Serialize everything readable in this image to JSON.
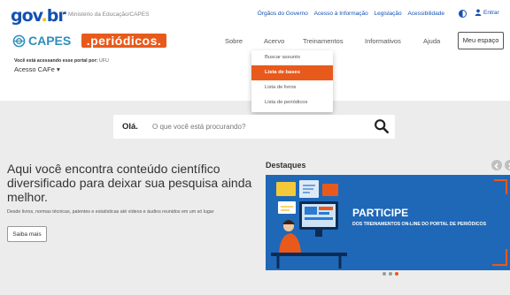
{
  "gov_bar": {
    "logo_parts": [
      "gov",
      ".",
      "br"
    ],
    "ministry": "Ministério da Educação/CAPES",
    "links": [
      "Órgãos do Governo",
      "Acesso à Informação",
      "Legislação",
      "Acessibilidade"
    ],
    "login_label": "Entrar"
  },
  "header": {
    "capes_label": "CAPES",
    "periodicos_label": ".periódicos.",
    "nav": [
      "Sobre",
      "Acervo",
      "Treinamentos",
      "Informativos",
      "Ajuda"
    ],
    "meu_espaco": "Meu espaço",
    "access_text": "Você está acessando esse portal por:",
    "access_institution": "UFU",
    "access_method": "Acesso CAFe"
  },
  "acervo_menu": {
    "items": [
      "Buscar assunto",
      "Lista de bases",
      "Lista de livros",
      "Lista de periódicos"
    ],
    "active_index": 1
  },
  "search": {
    "greeting": "Olá.",
    "placeholder": "O que você está procurando?"
  },
  "hero": {
    "title": "Aqui você encontra conteúdo científico diversificado para deixar sua pesquisa ainda melhor.",
    "description": "Desde livros, normas técnicas, patentes e estatísticas até vídeos e áudios reunidos em um só lugar",
    "button": "Saiba mais"
  },
  "highlights": {
    "title": "Destaques",
    "banner_title": "PARTICIPE",
    "banner_subtitle": "DOS TREINAMENTOS ON-LINE DO PORTAL DE PERIÓDICOS",
    "slides_total": 3,
    "active_slide": 2
  },
  "colors": {
    "brand_blue": "#1351b4",
    "brand_orange": "#e85a1c",
    "capes_teal": "#2e8eba",
    "banner_blue": "#1f68b7"
  }
}
